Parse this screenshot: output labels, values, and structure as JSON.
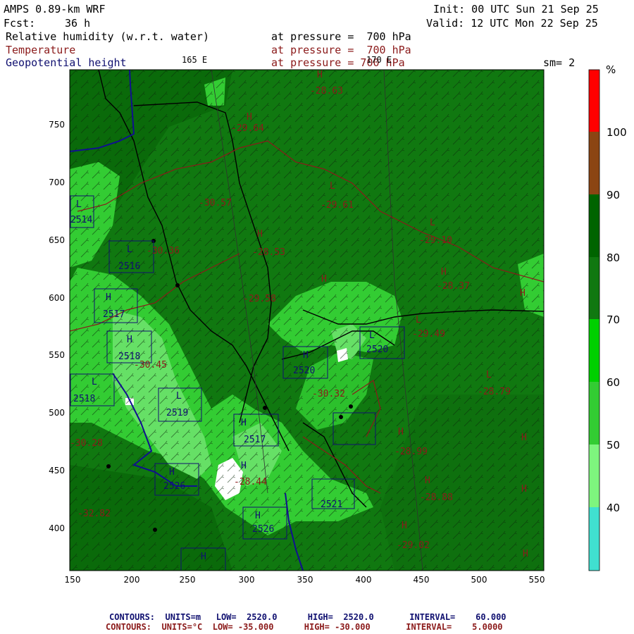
{
  "header": {
    "model": "AMPS 0.89-km WRF",
    "fcst_label": "Fcst:",
    "fcst_value": "36 h",
    "init": "Init: 00 UTC Sun 21 Sep 25",
    "valid": "Valid: 12 UTC Mon 22 Sep 25",
    "fields": [
      {
        "name": "Relative humidity (w.r.t. water)",
        "level": "at pressure =  700 hPa",
        "color": "#000000"
      },
      {
        "name": "Temperature",
        "level": "at pressure =  700 hPa",
        "color": "#8b1a1a"
      },
      {
        "name": "Geopotential height",
        "level": "at pressure = 700 hPa",
        "color": "#101070"
      }
    ],
    "lon_label_1": "165 E",
    "lon_label_2": "170 E",
    "smoothing": "sm= 2"
  },
  "axes": {
    "x_ticks": [
      "150",
      "200",
      "250",
      "300",
      "350",
      "400",
      "450",
      "500",
      "550"
    ],
    "y_ticks": [
      "750",
      "700",
      "650",
      "600",
      "550",
      "500",
      "450",
      "400"
    ]
  },
  "colorbar": {
    "unit": "%",
    "labels": [
      "40",
      "50",
      "60",
      "70",
      "80",
      "90",
      "100"
    ],
    "colors": [
      "#40e0d0",
      "#7ef57e",
      "#3cdc3c",
      "#00d000",
      "#107810",
      "#006400",
      "#8b4513",
      "#ff0000"
    ]
  },
  "temp_labels": [
    {
      "text": "-28.63"
    },
    {
      "text": "-29.64"
    },
    {
      "text": "-30.57"
    },
    {
      "text": "-29.61"
    },
    {
      "text": "-29.10"
    },
    {
      "text": "-28.53"
    },
    {
      "text": "-30.36"
    },
    {
      "text": "-28.37"
    },
    {
      "text": "-29.58"
    },
    {
      "text": "-29.49"
    },
    {
      "text": "-30.45"
    },
    {
      "text": "-30.32"
    },
    {
      "text": "-28.79"
    },
    {
      "text": "-30.28"
    },
    {
      "text": "-28.99"
    },
    {
      "text": "-28.44"
    },
    {
      "text": "-28.88"
    },
    {
      "text": "-32.82"
    },
    {
      "text": "-29.02"
    }
  ],
  "height_labels": [
    {
      "text": "2514"
    },
    {
      "text": "2516"
    },
    {
      "text": "2517"
    },
    {
      "text": "2518"
    },
    {
      "text": "2520"
    },
    {
      "text": "2520"
    },
    {
      "text": "2518"
    },
    {
      "text": "2519"
    },
    {
      "text": "2517"
    },
    {
      "text": "2526"
    },
    {
      "text": "2521"
    },
    {
      "text": "2526"
    }
  ],
  "footer": {
    "line1": "CONTOURS:  UNITS=m   LOW=  2520.0      HIGH=  2520.0       INTERVAL=    60.000",
    "line2": "CONTOURS:  UNITS=°C  LOW= -35.000      HIGH= -30.000       INTERVAL=    5.0000"
  }
}
